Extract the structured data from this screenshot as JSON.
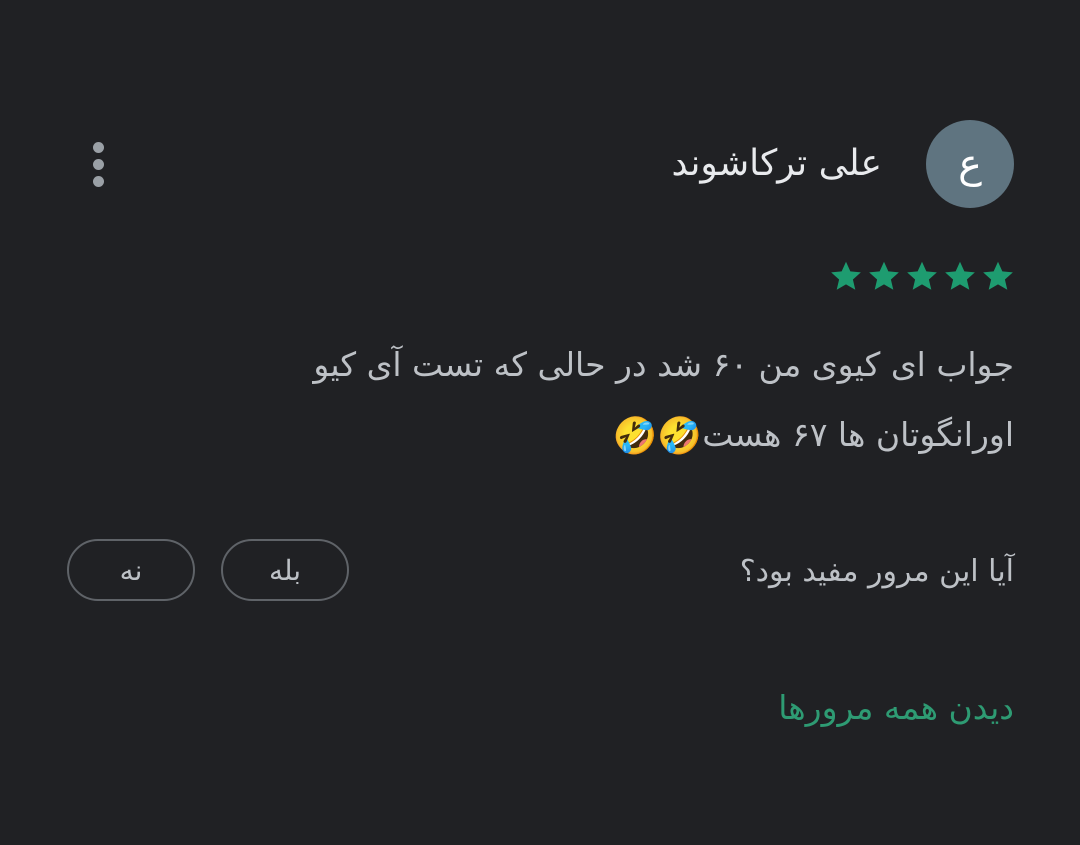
{
  "review": {
    "avatar_letter": "ع",
    "reviewer_name": "علی ترکاشوند",
    "menu_icon": "more-vert-icon",
    "rating": 5,
    "rating_max": 5,
    "star_color": "#1e9c70",
    "text_line1": "جواب ای کیوی من ۶۰ شد در حالی که تست آی کیو",
    "text_line2": "اورانگوتان ها ۶۷ هست",
    "emoji": "🤣🤣"
  },
  "helpful": {
    "question": "آیا این مرور مفید بود؟",
    "yes_label": "بله",
    "no_label": "نه"
  },
  "footer": {
    "see_all_label": "دیدن همه مرورها",
    "link_color": "#2e9b73"
  }
}
